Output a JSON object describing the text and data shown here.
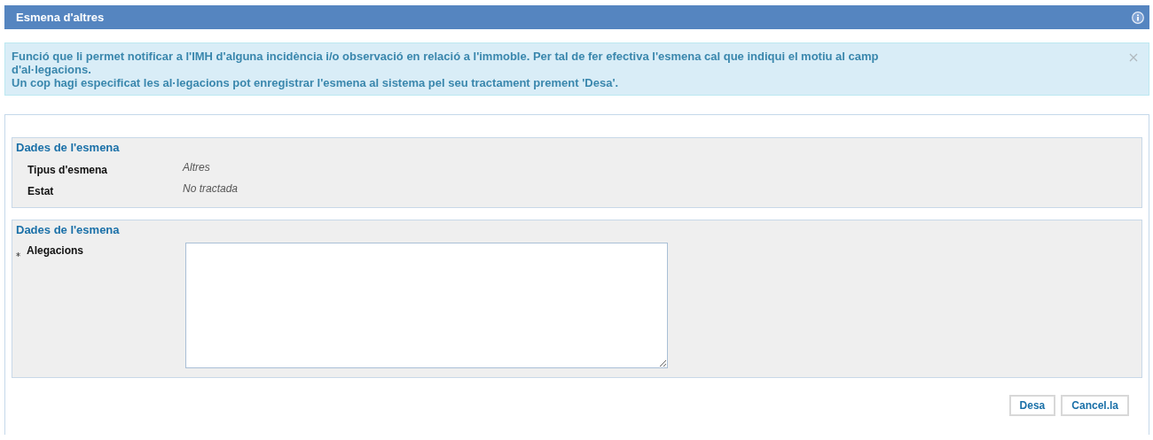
{
  "header": {
    "title": "Esmena d'altres"
  },
  "notice": {
    "paragraphs": [
      "Funció que li permet notificar a l'IMH d'alguna incidència i/o observació en relació a l'immoble. Per tal de fer efectiva l'esmena cal que indiqui el motiu al camp d'al·legacions.",
      "Un cop hagi especificat les al·legacions pot enregistrar l'esmena al sistema pel seu tractament prement 'Desa'."
    ]
  },
  "sections": [
    {
      "title": "Dades de l'esmena",
      "kind": "details",
      "fields": [
        {
          "label": "Tipus d'esmena",
          "value": "Altres"
        },
        {
          "label": "Estat",
          "value": "No tractada"
        }
      ]
    },
    {
      "title": "Dades de l'esmena",
      "kind": "form",
      "fields": [
        {
          "label": "Alegacions",
          "required": true
        }
      ]
    }
  ],
  "buttons": [
    "Desa",
    "Cancel.la"
  ]
}
